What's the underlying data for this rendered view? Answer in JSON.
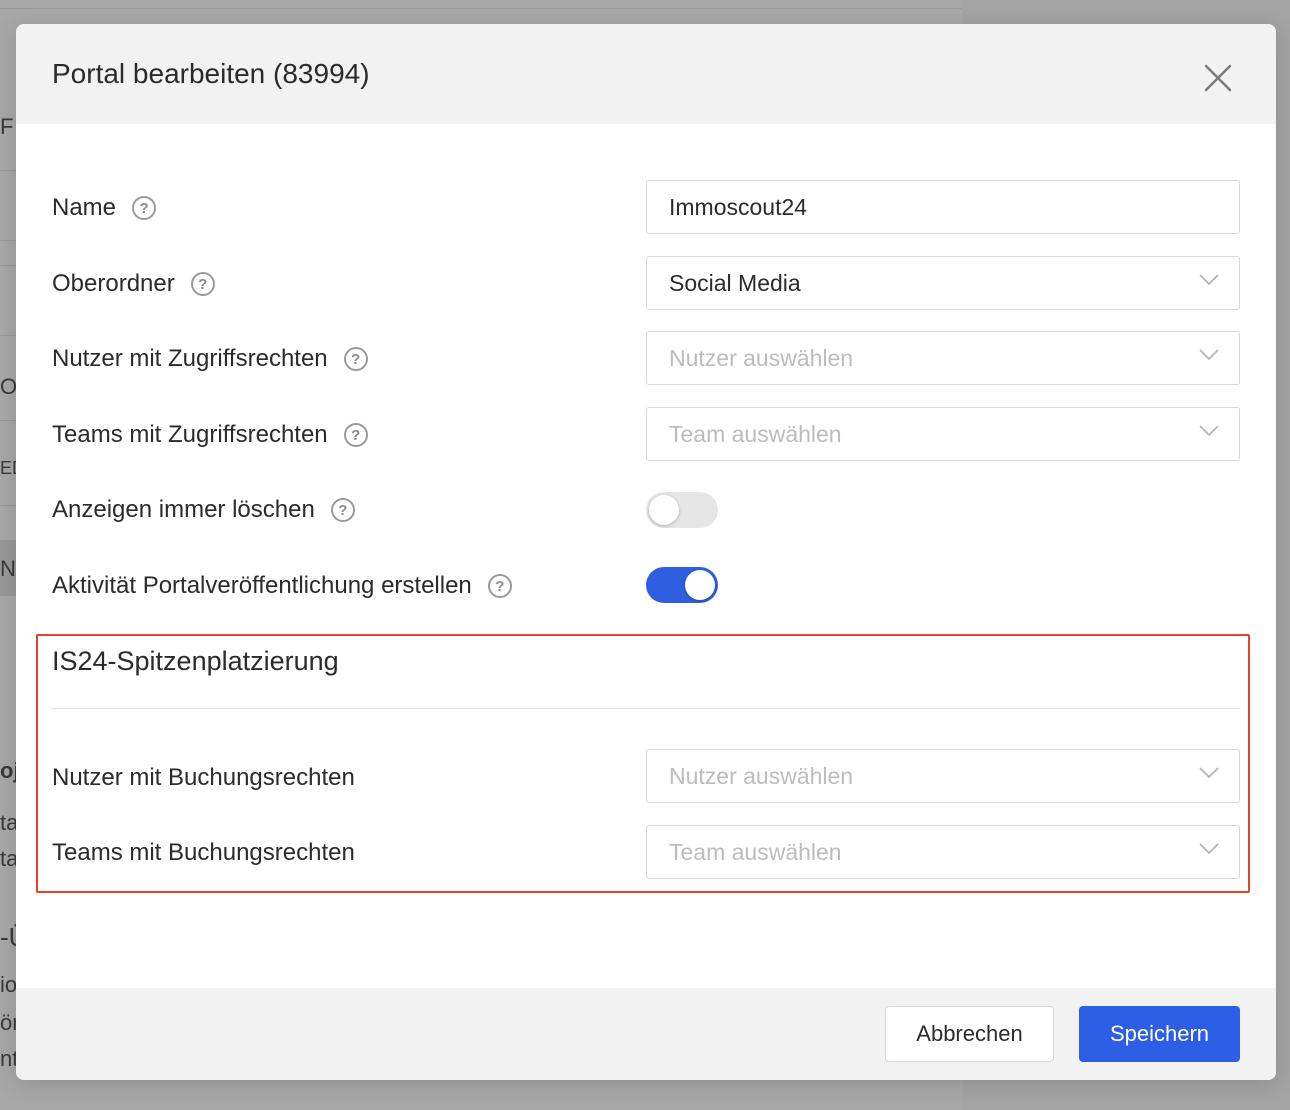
{
  "modal": {
    "title": "Portal bearbeiten (83994)"
  },
  "fields": {
    "name": {
      "label": "Name",
      "value": "Immoscout24"
    },
    "parent": {
      "label": "Oberordner",
      "value": "Social Media"
    },
    "users_access": {
      "label": "Nutzer mit Zugriffsrechten",
      "placeholder": "Nutzer auswählen"
    },
    "teams_access": {
      "label": "Teams mit Zugriffsrechten",
      "placeholder": "Team auswählen"
    },
    "always_delete": {
      "label": "Anzeigen immer löschen",
      "enabled": false
    },
    "create_activity": {
      "label": "Aktivität Portalveröffentlichung erstellen",
      "enabled": true
    }
  },
  "section": {
    "title": "IS24-Spitzenplatzierung",
    "users_booking": {
      "label": "Nutzer mit Buchungsrechten",
      "placeholder": "Nutzer auswählen"
    },
    "teams_booking": {
      "label": "Teams mit Buchungsrechten",
      "placeholder": "Team auswählen"
    }
  },
  "footer": {
    "cancel_label": "Abbrechen",
    "save_label": "Speichern"
  },
  "background_fragments": [
    "F",
    "O",
    "ED",
    "Ne",
    "oj",
    "ta",
    "ta",
    "-Ü",
    "io",
    "ör",
    "nt"
  ],
  "colors": {
    "accent": "#2d5fe6",
    "highlight": "#e0452a",
    "overlay": "#a4a4a4"
  },
  "icons": [
    "close-icon",
    "help-icon",
    "chevron-down-icon"
  ]
}
